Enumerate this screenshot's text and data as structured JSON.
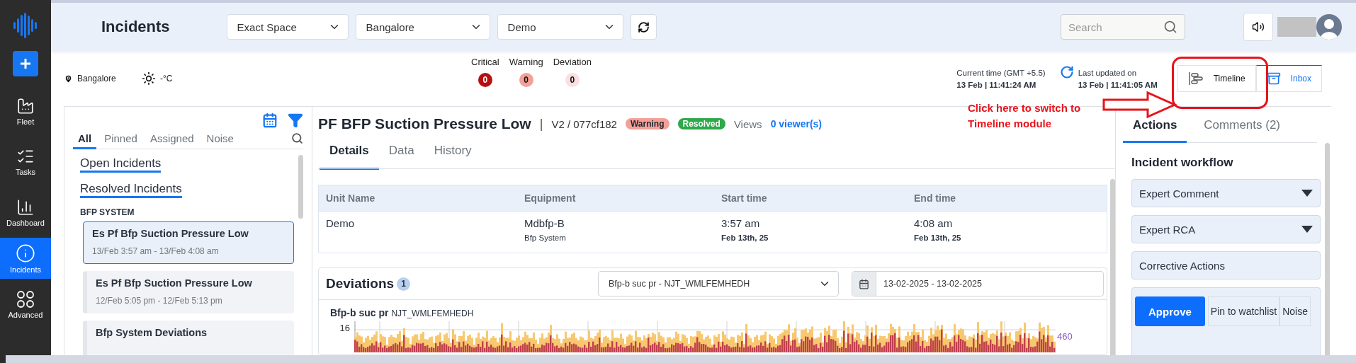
{
  "nav": {
    "items": [
      {
        "label": "Fleet",
        "selected": false
      },
      {
        "label": "Tasks",
        "selected": false
      },
      {
        "label": "Dashboard",
        "selected": false
      },
      {
        "label": "Incidents",
        "selected": true
      },
      {
        "label": "Advanced",
        "selected": false
      }
    ]
  },
  "header": {
    "title": "Incidents",
    "filters": [
      {
        "value": "Exact Space"
      },
      {
        "value": "Bangalore"
      },
      {
        "value": "Demo"
      }
    ],
    "search": {
      "placeholder": "Search"
    }
  },
  "location": "Bangalore",
  "temperature": "-°C",
  "severity_counts": [
    {
      "label": "Critical",
      "count": "0",
      "color": "#b50f0f"
    },
    {
      "label": "Warning",
      "count": "0",
      "color": "#f4a097"
    },
    {
      "label": "Deviation",
      "count": "0",
      "color": "#fbdfe0"
    }
  ],
  "current_time": {
    "label": "Current time (GMT +5.5)",
    "value": "13 Feb | 11:41:24 AM"
  },
  "last_updated": {
    "label": "Last updated on",
    "value": "13 Feb | 11:41:05 AM"
  },
  "view_switch": [
    {
      "label": "Timeline",
      "selected": false
    },
    {
      "label": "Inbox",
      "selected": true
    }
  ],
  "annotation": {
    "text": "Click here to switch to Timeline module"
  },
  "incident_list": {
    "tabs": [
      {
        "label": "All",
        "selected": true
      },
      {
        "label": "Pinned",
        "selected": false
      },
      {
        "label": "Assigned",
        "selected": false
      },
      {
        "label": "Noise",
        "selected": false
      }
    ],
    "sections": [
      "Open Incidents",
      "Resolved Incidents"
    ],
    "group": "BFP SYSTEM",
    "items": [
      {
        "title": "Es Pf Bfp Suction Pressure Low",
        "time": "13/Feb 3:57 am - 13/Feb 4:08 am",
        "selected": true
      },
      {
        "title": "Es Pf Bfp Suction Pressure Low",
        "time": "12/Feb 5:05 pm - 12/Feb 5:13 pm",
        "selected": false
      },
      {
        "title": "Bfp System Deviations",
        "selected": false
      }
    ]
  },
  "incident": {
    "title": "PF BFP Suction Pressure Low",
    "separator": "|",
    "version": "V2 / 077cf182",
    "badges": [
      {
        "label": "Warning",
        "color": "#f4a097"
      },
      {
        "label": "Resolved",
        "color": "#2ea84a"
      }
    ],
    "views_label": "Views",
    "viewers": "0 viewer(s)"
  },
  "detail_tabs": [
    {
      "label": "Details",
      "selected": true
    },
    {
      "label": "Data",
      "selected": false
    },
    {
      "label": "History",
      "selected": false
    }
  ],
  "details_table": {
    "columns": [
      "Unit Name",
      "Equipment",
      "Start time",
      "End time"
    ],
    "rows": [
      [
        {
          "text": "Demo"
        },
        {
          "text": "Mdbfp-B",
          "subtext": "Bfp System",
          "subtext_bold": false
        },
        {
          "text": "3:57 am",
          "subtext": "Feb 13th, 25",
          "subtext_bold": true
        },
        {
          "text": "4:08 am",
          "subtext": "Feb 13th, 25",
          "subtext_bold": true
        }
      ]
    ]
  },
  "deviations": {
    "title": "Deviations",
    "count": "1",
    "sensor_select": "Bfp-b suc pr - NJT_WMLFEMHEDH",
    "date_range": "13-02-2025 - 13-02-2025",
    "chart": {
      "title": "Bfp-b suc pr",
      "tag": "NJT_WMLFEMHEDH",
      "left_axis_label": "16",
      "right_axis_label": "460"
    }
  },
  "side_tabs": [
    {
      "label": "Actions",
      "selected": true
    },
    {
      "label": "Comments (2)",
      "selected": false
    }
  ],
  "workflow": {
    "title": "Incident workflow",
    "sections": [
      {
        "label": "Expert Comment",
        "expandable": true
      },
      {
        "label": "Expert RCA",
        "expandable": true
      },
      {
        "label": "Corrective Actions",
        "expandable": false
      }
    ],
    "buttons": [
      {
        "label": "Approve",
        "primary": true
      },
      {
        "label": "Pin to watchlist",
        "primary": false
      },
      {
        "label": "Noise",
        "primary": false
      }
    ]
  }
}
